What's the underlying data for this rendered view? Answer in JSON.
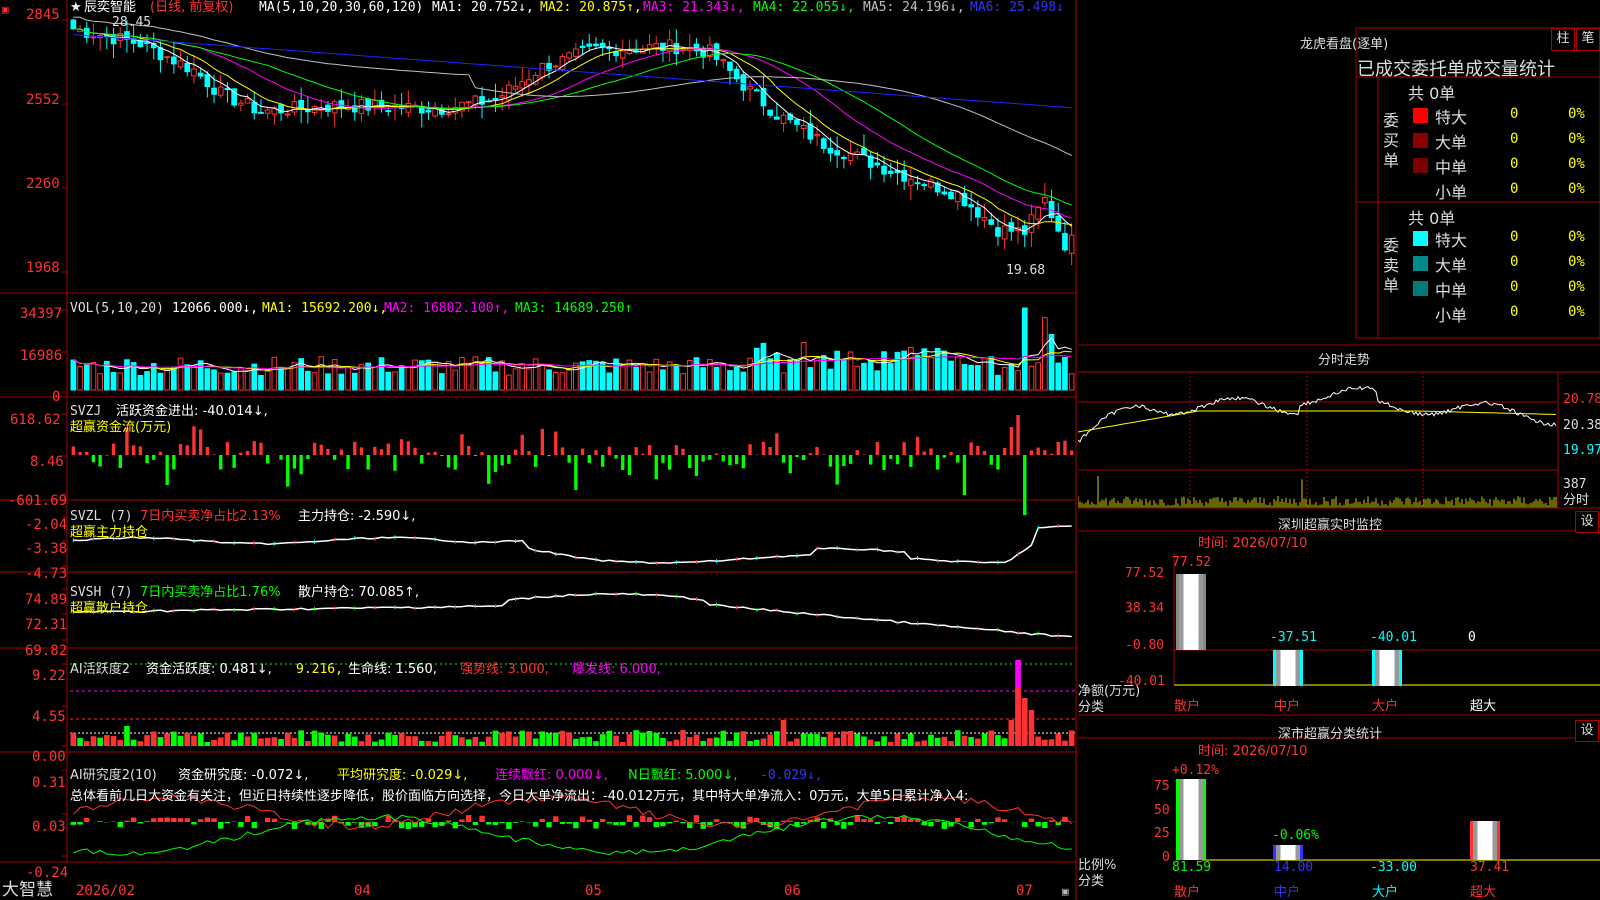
{
  "colors": {
    "up": "#ff3232",
    "down": "#00ffff",
    "ma1": "#ffffff",
    "ma2": "#ffff00",
    "ma3": "#ff00ff",
    "ma4": "#00ff00",
    "ma5": "#c0c0c0",
    "ma6": "#2222ff",
    "grid": "#a00000",
    "yellow": "#ffff00",
    "magenta": "#ff00ff",
    "green": "#00ff00",
    "cyan": "#00ffff",
    "red": "#ff3232",
    "white": "#ffffff"
  },
  "stock": {
    "name": "辰奕智能",
    "mode": "(日线, 前复权)",
    "ma_prefix": "MA(5,10,20,30,60,120)",
    "ma1": "MA1: 20.752↓,",
    "ma2": "MA2: 20.875↑,",
    "ma3": "MA3: 21.343↓,",
    "ma4": "MA4: 22.055↓,",
    "ma5": "MA5: 24.196↓,",
    "ma6": "MA6: 25.498↓",
    "high_mark": "28.45",
    "low_mark": "19.68",
    "axis": [
      "2845",
      "2552",
      "2260",
      "1968"
    ],
    "icon": "star-icon"
  },
  "vol": {
    "label": "VOL(5,10,20)",
    "value": "12066.000↓,",
    "ma1": "MA1: 15692.200↓,",
    "ma2": "MA2: 16802.100↑,",
    "ma3": "MA3: 14689.250↑",
    "axis": [
      "34397",
      "16986",
      "0"
    ]
  },
  "svzj": {
    "label": "SVZJ",
    "title": "活跃资金进出: -40.014↓,",
    "sub": "超赢资金流(万元)",
    "axis": [
      "618.62",
      "8.46",
      "-601.69"
    ]
  },
  "svzl": {
    "label": "SVZL (7)",
    "t1": "7日内买卖净占比2.13%",
    "t2": "主力持仓: -2.590↓,",
    "sub": "超赢主力持仓",
    "axis": [
      "-2.04",
      "-3.38",
      "-4.73"
    ]
  },
  "svsh": {
    "label": "SVSH (7)",
    "t1": "7日内买卖净占比1.76%",
    "t2": "散户持仓: 70.085↑,",
    "sub": "超赢散户持仓",
    "axis": [
      "74.89",
      "72.31",
      "69.82"
    ]
  },
  "ai1": {
    "label": "AI活跃度2",
    "t1": "资金活跃度: 0.481↓,",
    "t2": "9.216,",
    "t3": "生命线: 1.560,",
    "t4": "强势线: 3.000,",
    "t5": "爆发线: 6.000,",
    "axis": [
      "9.22",
      "4.55",
      "0.00"
    ]
  },
  "ai2": {
    "label": "AI研究度2(10)",
    "t1": "资金研究度: -0.072↓,",
    "t2": "平均研究度: -0.029↓,",
    "t3": "连续飘红: 0.000↓,",
    "t4": "N日飘红: 5.000↓,",
    "t5": "-0.029↓,",
    "desc": "总体看前几日大资金有关注，但近日持续性逐步降低，股价面临方向选择，今日大单净流出：-40.012万元，其中特大单净流入：0万元，大单5日累计净入4:",
    "axis": [
      "0.31",
      "0.03",
      "-0.24"
    ]
  },
  "dates": [
    "2026/02",
    "04",
    "05",
    "06",
    "07"
  ],
  "brand": "大智慧",
  "lhb": {
    "title": "龙虎看盘(逐单)",
    "btn1": "柱",
    "btn2": "笔",
    "header": "已成交委托单成交量统计",
    "buy_label": "委买单",
    "sell_label": "委卖单",
    "buy_total": "共 0单",
    "sell_total": "共 0单",
    "buy_rows": [
      {
        "label": "特大",
        "v": "0",
        "p": "0%",
        "c": "#ff0000"
      },
      {
        "label": "大单",
        "v": "0",
        "p": "0%",
        "c": "#8b0000"
      },
      {
        "label": "中单",
        "v": "0",
        "p": "0%",
        "c": "#7a0000"
      },
      {
        "label": "小单",
        "v": "0",
        "p": "0%",
        "c": ""
      }
    ],
    "sell_rows": [
      {
        "label": "特大",
        "v": "0",
        "p": "0%",
        "c": "#00ffff"
      },
      {
        "label": "大单",
        "v": "0",
        "p": "0%",
        "c": "#008b8b"
      },
      {
        "label": "中单",
        "v": "0",
        "p": "0%",
        "c": "#007a7a"
      },
      {
        "label": "小单",
        "v": "0",
        "p": "0%",
        "c": ""
      }
    ]
  },
  "fenshi": {
    "title": "分时走势",
    "axis": [
      "20.78",
      "20.38",
      "19.97"
    ],
    "vol_label": "387",
    "vol_sub": "分时"
  },
  "monitor": {
    "title": "深圳超赢实时监控",
    "btn": "设",
    "time": "时间: 2026/07/10",
    "axis": [
      "77.52",
      "38.34",
      "-0.80",
      "-40.01"
    ],
    "unit": "净额(万元)",
    "cat_label": "分类",
    "cats": [
      "散户",
      "中户",
      "大户",
      "超大"
    ],
    "values": [
      "77.52",
      "-37.51",
      "-40.01",
      "0"
    ]
  },
  "classify": {
    "title": "深市超赢分类统计",
    "btn": "设",
    "time": "时间: 2026/07/10",
    "axis": [
      "75",
      "50",
      "25",
      "0"
    ],
    "unit": "比例%",
    "cat_label": "分类",
    "cats": [
      "散户",
      "中户",
      "大户",
      "超大"
    ],
    "top": [
      "+0.12%",
      "-0.06%"
    ],
    "values": [
      "81.59",
      "14.00",
      "-33.00",
      "37.41"
    ]
  }
}
